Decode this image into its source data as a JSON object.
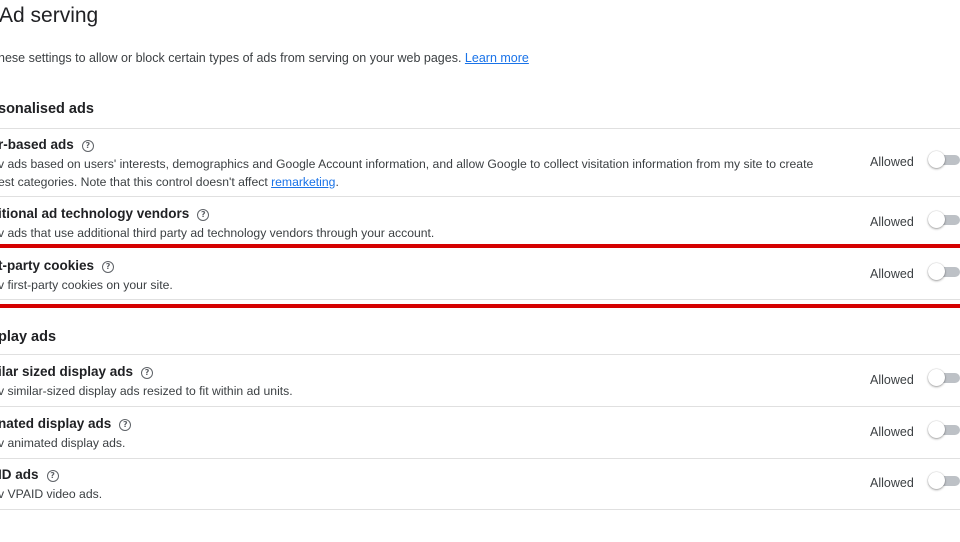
{
  "page": {
    "title": "Ad serving",
    "intro_text": "hese settings to allow or block certain types of ads from serving on your web pages.",
    "learn_more": "Learn more"
  },
  "sections": {
    "personalised": {
      "heading": "sonalised ads",
      "rows": [
        {
          "title": "r-based ads",
          "desc_line1": "v ads based on users' interests, demographics and Google Account information, and allow Google to collect visitation information from my site to create",
          "desc_line2_pre": "est categories. Note that this control doesn't affect ",
          "desc_link": "remarketing",
          "desc_line2_post": ".",
          "status": "Allowed"
        },
        {
          "title": "itional ad technology vendors",
          "desc": "v ads that use additional third party ad technology vendors through your account.",
          "status": "Allowed"
        },
        {
          "title": "t-party cookies",
          "desc": "v first-party cookies on your site.",
          "status": "Allowed"
        }
      ]
    },
    "display": {
      "heading": "play ads",
      "rows": [
        {
          "title": "ilar sized display ads",
          "desc": "v similar-sized display ads resized to fit within ad units.",
          "status": "Allowed"
        },
        {
          "title": "nated display ads",
          "desc": "v animated display ads.",
          "status": "Allowed"
        },
        {
          "title": "ID ads",
          "desc": "v VPAID video ads.",
          "status": "Allowed"
        }
      ]
    }
  },
  "icons": {
    "help": "help-circle-icon",
    "help_glyph": "?"
  },
  "colors": {
    "highlight": "#d50000",
    "link": "#1a73e8",
    "toggle_track": "#bdc1c6"
  }
}
